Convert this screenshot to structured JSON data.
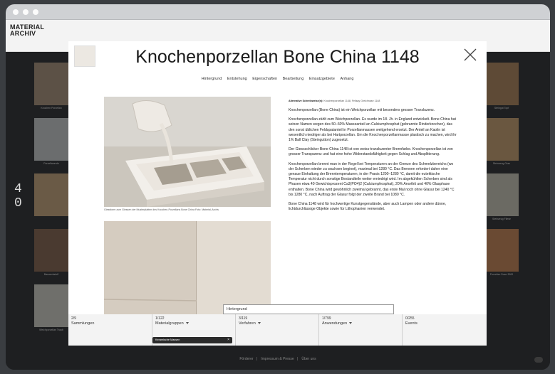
{
  "app": {
    "logo_line1": "MATERIAL",
    "logo_line2": "ARCHIV",
    "pager_top": "4",
    "pager_bottom": "0"
  },
  "background": {
    "left_captions": [
      "Knochen Porzellan",
      "Porzellanerde",
      "",
      "Bauwerkstoff",
      "Gebrannte Ton",
      "Weichporzellan Traub"
    ],
    "right_captions": [
      "Steingut Topf",
      "Steinzeug Grau",
      "Steinzeug Fliese",
      "Porzellan Dose 3000"
    ],
    "footer_links": [
      "Förderer",
      "Impressum & Presse",
      "Über uns"
    ]
  },
  "modal": {
    "title": "Knochenporzellan Bone China 1148",
    "tabs": [
      "Hintergrund",
      "Entstehung",
      "Eigenschaften",
      "Bearbeitung",
      "Einsatzgebiete",
      "Anhang"
    ],
    "image1_caption": "Giessform zum Giessen der Musterplatten des Knochen-Porzellans Bone China Foto: Material-Archiv",
    "alt_name_label": "Alternative Schreibweise(n):",
    "alt_name_value": "Knochenporzellan 1148, Fellsay Greichnase 1148",
    "paragraphs": [
      "Knochenporzellan (Bone China) ist ein Weichporzellan mit besonders grosser Transluzenz.",
      "Knochenporzellan zählt zum Weichporzellan. Es wurde im 18. Jh. in England entwickelt. Bone China hat seinen Namen wegen des 50–60% Masseanteil an Calciumphosphat (gebrannte Rinderknochen), das den sonst üblichen Feldspatanteil in Porzellanmassen weitgehend ersetzt. Der Anteil an Kaolin ist wesentlich niedriger als bei Hartporzellan. Um die Knochenporzellanmasse plastisch zu machen, wird ihr 1% Ball Clay (Steingutton) zugesetzt.",
      "Der Giessschlicker Bone China 1148 ist von weiss-transluzenter Brennfarbe. Knochenporzellan ist von grosser Transparenz und hat eine hohe Widerstandsfähigkeit gegen Schlag und Absplitterung.",
      "Knochenporzellan brennt man in der Regel bei Temperaturen an der Grenze des Schmelzbereichs (wo der Scherben wieder zu wachsen beginnt), maximal bei 1280 °C. Das Brennen erfordert daher eine genaue Einhaltung der Brenntemperaturen, in der Praxis 1200–1280 °C, damit die eutektische Temperatur nicht durch sonstige Bestandteile weiter erniedrigt wird. Im abgekühlten Scherben sind als Phasen etwa 40 Gewichtsprozent Ca3(PO4)2 (Calciumphosphat), 20% Anorthit und 40% Glasphase enthalten. Bone China wird gewöhnlich zweimal gebrannt, das erste Mal noch ohne Glasur bei 1240 °C bis 1280 °C, nach Auftrag der Glasur folgt der zweite Brand bei 1080 °C.",
      "Bone China 1148 wird für hochwertige Kunstgegenstände, aber auch Lampen oder andere dünne, lichtdurchlässige Objekte sowie für Lithophanien verwendet."
    ],
    "section_select": "Hintergrund"
  },
  "filters": [
    {
      "count": "2/9",
      "label": "Sammlungen"
    },
    {
      "count": "1/122",
      "label": "Materialgruppen"
    },
    {
      "count": "3/119",
      "label": "Verfahren"
    },
    {
      "count": "1/799",
      "label": "Anwendungen"
    },
    {
      "count": "0/255",
      "label": "Events"
    }
  ],
  "active_chip": "Keramische Massen",
  "colors": {
    "frame": "#1b1c1e",
    "modal_bg": "#ffffff",
    "chip_bg": "#2b2b2b"
  }
}
